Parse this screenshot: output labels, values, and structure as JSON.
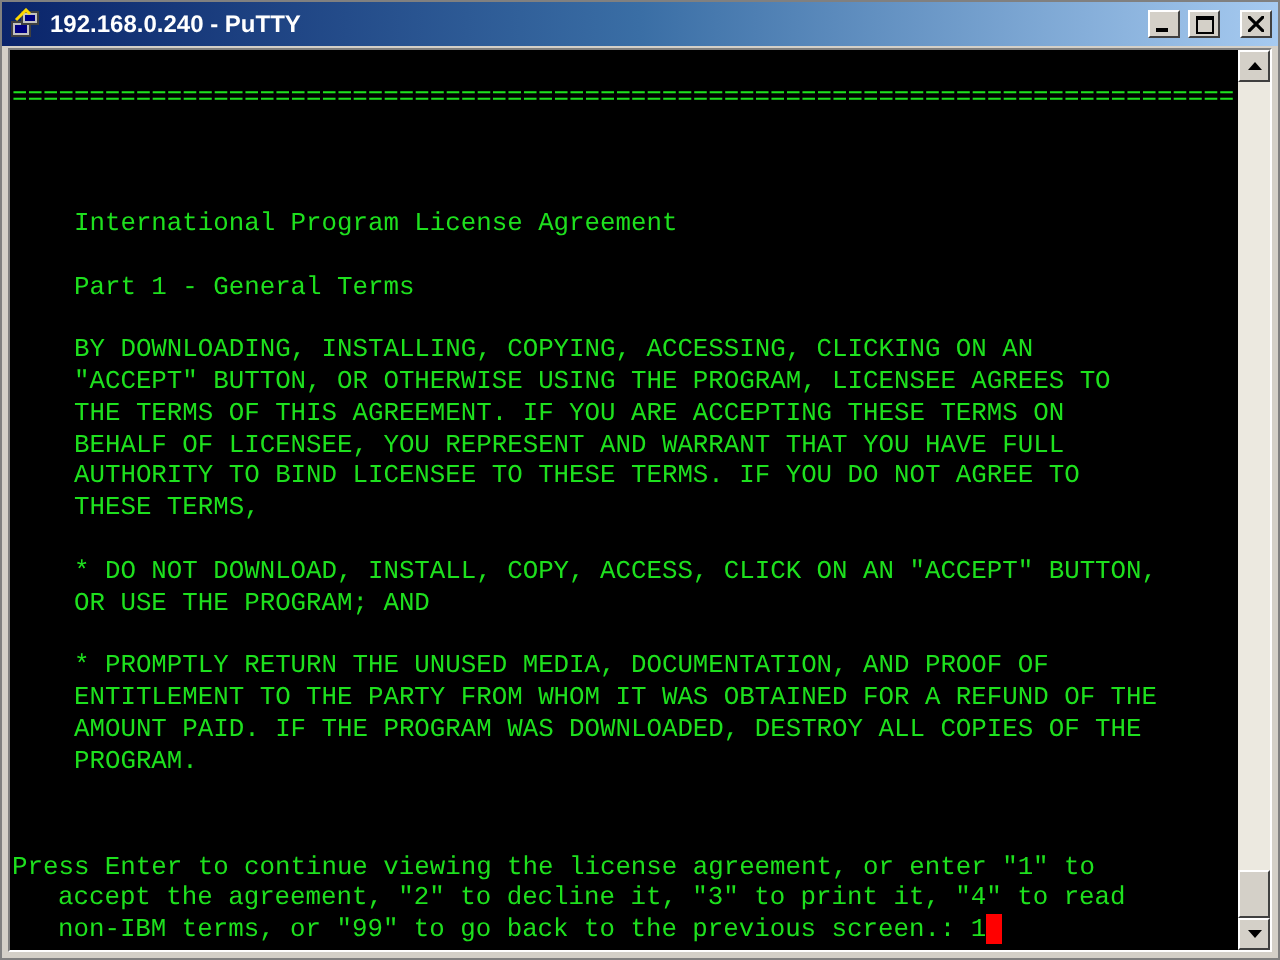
{
  "window": {
    "title": "192.168.0.240 - PuTTY"
  },
  "terminal": {
    "separator": "===============================================================================",
    "paragraphs": [
      [
        "International Program License Agreement"
      ],
      [
        "Part 1 - General Terms"
      ],
      [
        "BY DOWNLOADING, INSTALLING, COPYING, ACCESSING, CLICKING ON AN",
        "\"ACCEPT\" BUTTON, OR OTHERWISE USING THE PROGRAM, LICENSEE AGREES TO",
        "THE TERMS OF THIS AGREEMENT. IF YOU ARE ACCEPTING THESE TERMS ON",
        "BEHALF OF LICENSEE, YOU REPRESENT AND WARRANT THAT YOU HAVE FULL",
        "AUTHORITY TO BIND LICENSEE TO THESE TERMS. IF YOU DO NOT AGREE TO",
        "THESE TERMS,"
      ],
      [
        "* DO NOT DOWNLOAD, INSTALL, COPY, ACCESS, CLICK ON AN \"ACCEPT\" BUTTON,",
        "OR USE THE PROGRAM; AND"
      ],
      [
        "* PROMPTLY RETURN THE UNUSED MEDIA, DOCUMENTATION, AND PROOF OF",
        "ENTITLEMENT TO THE PARTY FROM WHOM IT WAS OBTAINED FOR A REFUND OF THE",
        "AMOUNT PAID. IF THE PROGRAM WAS DOWNLOADED, DESTROY ALL COPIES OF THE",
        "PROGRAM."
      ]
    ],
    "prompt": [
      "Press Enter to continue viewing the license agreement, or enter \"1\" to",
      "accept the agreement, \"2\" to decline it, \"3\" to print it, \"4\" to read",
      "non-IBM terms, or \"99\" to go back to the previous screen.: 1"
    ]
  }
}
